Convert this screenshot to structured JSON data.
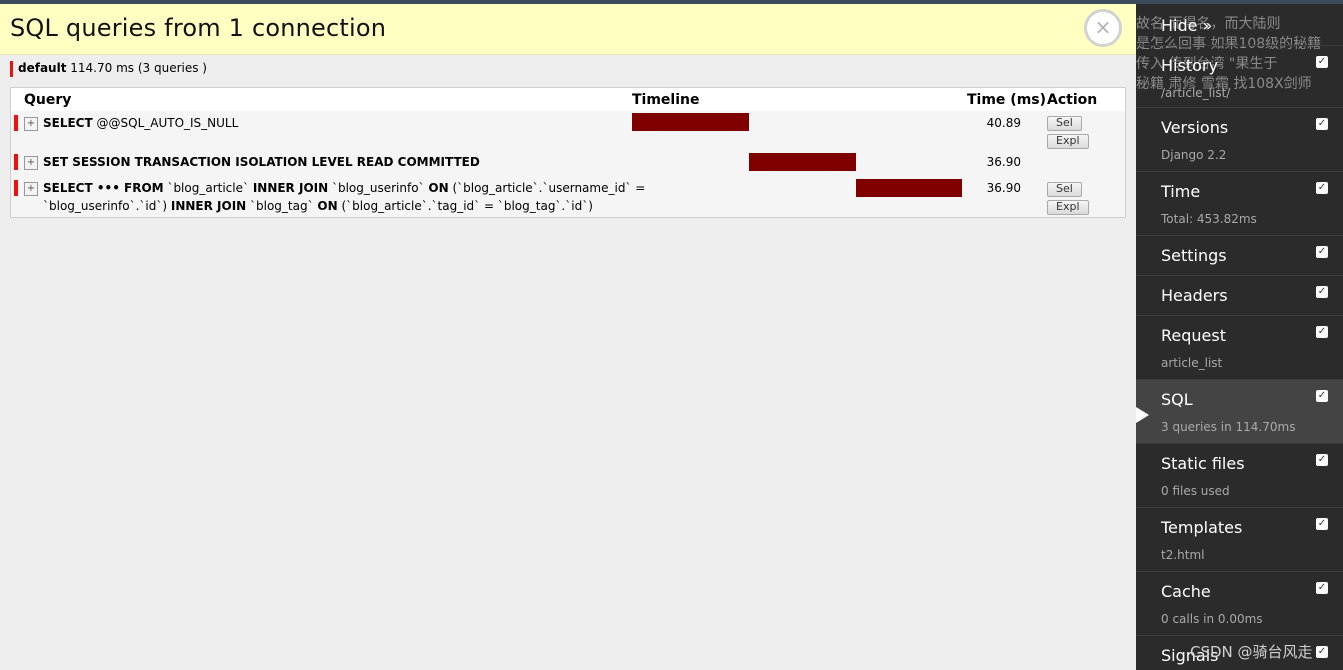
{
  "panel": {
    "title": "SQL queries from 1 connection",
    "close_symbol": "×"
  },
  "connection": {
    "name": "default",
    "summary": "114.70 ms (3 queries )"
  },
  "table": {
    "headers": {
      "query": "Query",
      "timeline": "Timeline",
      "time": "Time (ms)",
      "action": "Action"
    }
  },
  "queries": [
    {
      "toggle": "+",
      "sql": [
        {
          "kw": "SELECT",
          "txt": " @@SQL_AUTO_IS_NULL"
        }
      ],
      "time": "40.89",
      "timeline_start_pct": 0,
      "timeline_width_pct": 35.6,
      "actions": [
        "Sel",
        "Expl"
      ]
    },
    {
      "toggle": "+",
      "sql": [
        {
          "kw": "SET SESSION TRANSACTION ISOLATION LEVEL READ COMMITTED",
          "txt": ""
        }
      ],
      "time": "36.90",
      "timeline_start_pct": 35.6,
      "timeline_width_pct": 32.2,
      "actions": []
    },
    {
      "toggle": "+",
      "sql_line1": [
        {
          "kw": "SELECT ••• FROM",
          "txt": " `blog_article` "
        },
        {
          "kw": "INNER JOIN",
          "txt": " `blog_userinfo` "
        },
        {
          "kw": "ON",
          "txt": " (`blog_article`.`username_id` ="
        }
      ],
      "sql_line2": [
        {
          "kw": "",
          "txt": "`blog_userinfo`.`id`) "
        },
        {
          "kw": "INNER JOIN",
          "txt": " `blog_tag` "
        },
        {
          "kw": "ON",
          "txt": " (`blog_article`.`tag_id` = `blog_tag`.`id`)"
        }
      ],
      "time": "36.90",
      "timeline_start_pct": 67.8,
      "timeline_width_pct": 32.2,
      "actions": [
        "Sel",
        "Expl"
      ]
    }
  ],
  "toolbar": {
    "hide_label": "Hide »",
    "background_text": [
      "故名                  而得名，而大陆则",
      "是怎么回事 如果108级的秘籍",
      "传入                   传到台湾 \"果生于",
      "秘籍 肃修 雪霜 找108X剑师"
    ],
    "panels": [
      {
        "title": "History",
        "subtitle": "/article_list/",
        "checked": true
      },
      {
        "title": "Versions",
        "subtitle": "Django 2.2",
        "checked": true
      },
      {
        "title": "Time",
        "subtitle": "Total: 453.82ms",
        "checked": true
      },
      {
        "title": "Settings",
        "subtitle": "",
        "checked": true
      },
      {
        "title": "Headers",
        "subtitle": "",
        "checked": true
      },
      {
        "title": "Request",
        "subtitle": "article_list",
        "checked": true
      },
      {
        "title": "SQL",
        "subtitle": "3 queries in 114.70ms",
        "checked": true,
        "active": true
      },
      {
        "title": "Static files",
        "subtitle": "0 files used",
        "checked": true
      },
      {
        "title": "Templates",
        "subtitle": "t2.html",
        "checked": true
      },
      {
        "title": "Cache",
        "subtitle": "0 calls in 0.00ms",
        "checked": true
      },
      {
        "title": "Signals",
        "subtitle": "",
        "checked": true
      }
    ],
    "watermark": "CSDN @骑台风走"
  },
  "colors": {
    "header_bg": "#ffffc2",
    "timeline_bar": "#800000",
    "query_marker": "#ee1111",
    "toolbar_bg": "#2b2b2b",
    "toolbar_active": "#444444"
  }
}
